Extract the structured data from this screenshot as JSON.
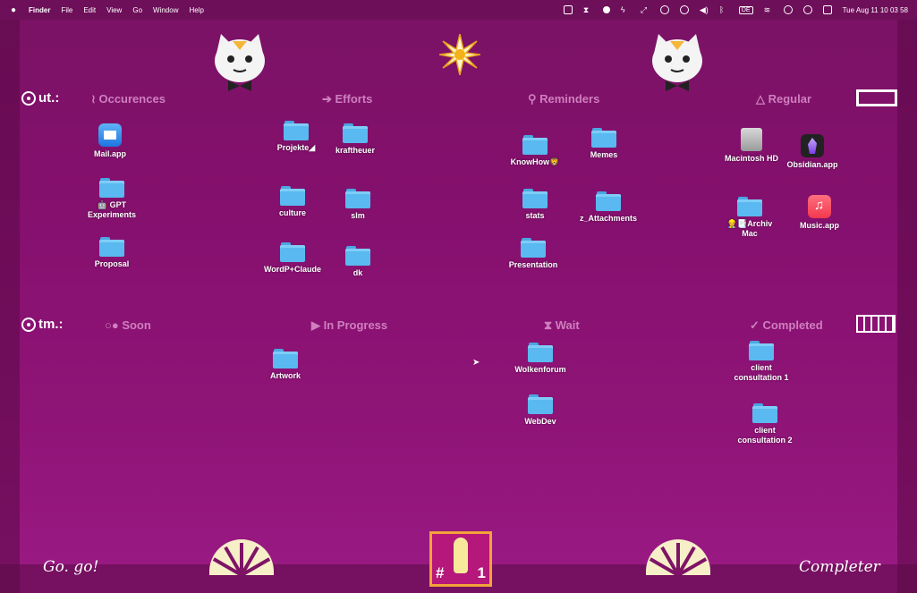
{
  "menubar": {
    "app": "Finder",
    "menus": [
      "File",
      "Edit",
      "View",
      "Go",
      "Window",
      "Help"
    ],
    "input_source": "DE",
    "clock": "Tue Aug 11  10 03 58"
  },
  "rows": {
    "top_label": "ut.:",
    "bottom_label": "tm.:"
  },
  "headers": {
    "occurences": "≀ Occurences",
    "efforts": "➔ Efforts",
    "reminders": "⚲ Reminders",
    "regular": "△ Regular",
    "soon": "○● Soon",
    "in_progress": "▶ In Progress",
    "wait": "⧗ Wait",
    "completed": "✓ Completed"
  },
  "items": {
    "mail": "Mail.app",
    "gpt": "🤖 GPT\nExperiments",
    "proposal": "Proposal",
    "projekte": "Projekte◢",
    "kraftheuer": "kraftheuer",
    "culture": "culture",
    "slm": "slm",
    "wordp": "WordP+Claude",
    "dk": "dk",
    "knowhow": "KnowHow🦁",
    "memes": "Memes",
    "stats": "stats",
    "attachments": "z_Attachments",
    "presentation": "Presentation",
    "macintosh": "Macintosh HD",
    "obsidian": "Obsidian.app",
    "archiv": "👷📑Archiv\nMac",
    "music": "Music.app",
    "artwork": "Artwork",
    "wolkenforum": "Wolkenforum",
    "webdev": "WebDev",
    "client1": "client\nconsultation 1",
    "client2": "client\nconsultation 2"
  },
  "bottom": {
    "left_sig": "Go. go!",
    "right_sig": "Completer",
    "badge_hash": "#",
    "badge_one": "1"
  }
}
